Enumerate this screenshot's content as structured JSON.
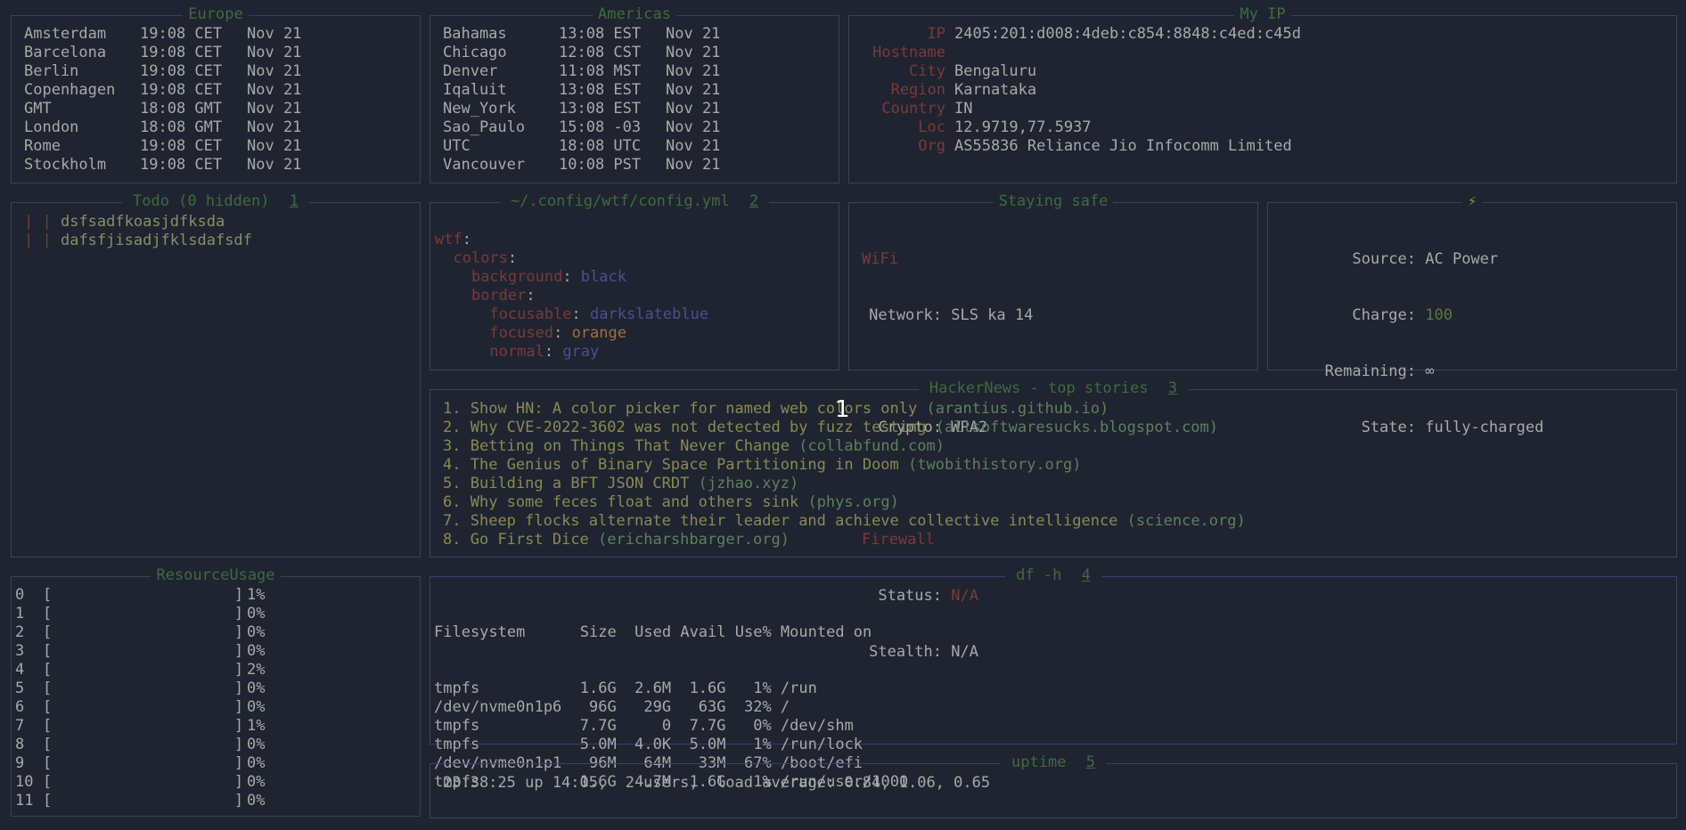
{
  "europe": {
    "title": "Europe",
    "rows": [
      {
        "city": "Amsterdam",
        "time": "19:08 CET",
        "date": "Nov 21"
      },
      {
        "city": "Barcelona",
        "time": "19:08 CET",
        "date": "Nov 21"
      },
      {
        "city": "Berlin",
        "time": "19:08 CET",
        "date": "Nov 21"
      },
      {
        "city": "Copenhagen",
        "time": "19:08 CET",
        "date": "Nov 21"
      },
      {
        "city": "GMT",
        "time": "18:08 GMT",
        "date": "Nov 21"
      },
      {
        "city": "London",
        "time": "18:08 GMT",
        "date": "Nov 21"
      },
      {
        "city": "Rome",
        "time": "19:08 CET",
        "date": "Nov 21"
      },
      {
        "city": "Stockholm",
        "time": "19:08 CET",
        "date": "Nov 21"
      }
    ]
  },
  "americas": {
    "title": "Americas",
    "rows": [
      {
        "city": "Bahamas",
        "time": "13:08 EST",
        "date": "Nov 21"
      },
      {
        "city": "Chicago",
        "time": "12:08 CST",
        "date": "Nov 21"
      },
      {
        "city": "Denver",
        "time": "11:08 MST",
        "date": "Nov 21"
      },
      {
        "city": "Iqaluit",
        "time": "13:08 EST",
        "date": "Nov 21"
      },
      {
        "city": "New_York",
        "time": "13:08 EST",
        "date": "Nov 21"
      },
      {
        "city": "Sao_Paulo",
        "time": "15:08 -03",
        "date": "Nov 21"
      },
      {
        "city": "UTC",
        "time": "18:08 UTC",
        "date": "Nov 21"
      },
      {
        "city": "Vancouver",
        "time": "10:08 PST",
        "date": "Nov 21"
      }
    ]
  },
  "myip": {
    "title": "My IP",
    "rows": [
      {
        "label": "IP",
        "value": "2405:201:d008:4deb:c854:8848:c4ed:c45d"
      },
      {
        "label": "Hostname",
        "value": ""
      },
      {
        "label": "City",
        "value": "Bengaluru"
      },
      {
        "label": "Region",
        "value": "Karnataka"
      },
      {
        "label": "Country",
        "value": "IN"
      },
      {
        "label": "Loc",
        "value": "12.9719,77.5937"
      },
      {
        "label": "Org",
        "value": "AS55836 Reliance Jio Infocomm Limited"
      }
    ]
  },
  "todo": {
    "title": "Todo (0 hidden)",
    "num": "1",
    "items": [
      {
        "check": "| |",
        "text": "dsfsadfkoasjdfksda"
      },
      {
        "check": "| |",
        "text": "dafsfjisadjfklsdafsdf"
      }
    ]
  },
  "config": {
    "title": "~/.config/wtf/config.yml",
    "num": "2",
    "lines": [
      {
        "indent": "",
        "key": "wtf",
        "value": ""
      },
      {
        "indent": "  ",
        "key": "colors",
        "value": ""
      },
      {
        "indent": "    ",
        "key": "background",
        "value": "black"
      },
      {
        "indent": "    ",
        "key": "border",
        "value": ""
      },
      {
        "indent": "      ",
        "key": "focusable",
        "value": "darkslateblue"
      },
      {
        "indent": "      ",
        "key": "focused",
        "value": "orange"
      },
      {
        "indent": "      ",
        "key": "normal",
        "value": "gray"
      }
    ]
  },
  "security": {
    "title": "Staying safe",
    "wifi_header": "WiFi",
    "network_label": "Network:",
    "network_value": "SLS ka 14",
    "crypto_label": "Crypto:",
    "crypto_value": "WPA2",
    "firewall_header": "Firewall",
    "status_label": "Status:",
    "status_value": "N/A",
    "stealth_label": "Stealth:",
    "stealth_value": "N/A"
  },
  "power": {
    "title": "⚡",
    "source_label": "Source:",
    "source_value": "AC Power",
    "charge_label": "Charge:",
    "charge_value": "100",
    "remaining_label": "Remaining:",
    "remaining_value": "∞",
    "state_label": "State:",
    "state_value": "fully-charged"
  },
  "hackernews": {
    "title": "HackerNews - top stories",
    "num": "3",
    "stories": [
      {
        "n": "1.",
        "title": "Show HN: A color picker for named web colors only",
        "site": "(arantius.github.io)"
      },
      {
        "n": "2.",
        "title": "Why CVE-2022-3602 was not detected by fuzz testing",
        "site": "(allsoftwaresucks.blogspot.com)"
      },
      {
        "n": "3.",
        "title": "Betting on Things That Never Change",
        "site": "(collabfund.com)"
      },
      {
        "n": "4.",
        "title": "The Genius of Binary Space Partitioning in Doom",
        "site": "(twobithistory.org)"
      },
      {
        "n": "5.",
        "title": "Building a BFT JSON CRDT",
        "site": "(jzhao.xyz)"
      },
      {
        "n": "6.",
        "title": "Why some feces float and others sink",
        "site": "(phys.org)"
      },
      {
        "n": "7.",
        "title": "Sheep flocks alternate their leader and achieve collective intelligence",
        "site": "(science.org)"
      },
      {
        "n": "8.",
        "title": "Go First Dice",
        "site": "(ericharshbarger.org)"
      }
    ]
  },
  "resources": {
    "title": "ResourceUsage",
    "cpus": [
      {
        "id": "0",
        "pct": "1%"
      },
      {
        "id": "1",
        "pct": "0%"
      },
      {
        "id": "2",
        "pct": "0%"
      },
      {
        "id": "3",
        "pct": "0%"
      },
      {
        "id": "4",
        "pct": "2%"
      },
      {
        "id": "5",
        "pct": "0%"
      },
      {
        "id": "6",
        "pct": "0%"
      },
      {
        "id": "7",
        "pct": "1%"
      },
      {
        "id": "8",
        "pct": "0%"
      },
      {
        "id": "9",
        "pct": "0%"
      },
      {
        "id": "10",
        "pct": "0%"
      },
      {
        "id": "11",
        "pct": "0%"
      }
    ]
  },
  "df": {
    "title": "df -h",
    "num": "4",
    "header": "Filesystem      Size  Used Avail Use% Mounted on",
    "lines": [
      "tmpfs           1.6G  2.6M  1.6G   1% /run",
      "/dev/nvme0n1p6   96G   29G   63G  32% /",
      "tmpfs           7.7G     0  7.7G   0% /dev/shm",
      "tmpfs           5.0M  4.0K  5.0M   1% /run/lock",
      "/dev/nvme0n1p1   96M   64M   33M  67% /boot/efi",
      "tmpfs           1.6G  4.7M  1.6G   1% /run/user/1000"
    ]
  },
  "uptime": {
    "title": "uptime",
    "num": "5",
    "text": "23:38:25 up 14:05,  2 users,  load average: 0.84, 1.06, 0.65"
  },
  "overlay": {
    "number": "1"
  },
  "colors": {
    "background": "#1f2430",
    "border": "#3b4253",
    "title_green": "#3f6b3f",
    "key_red": "#7a3a3a",
    "value_blue": "#4a4f8f",
    "orange": "#a07040"
  }
}
